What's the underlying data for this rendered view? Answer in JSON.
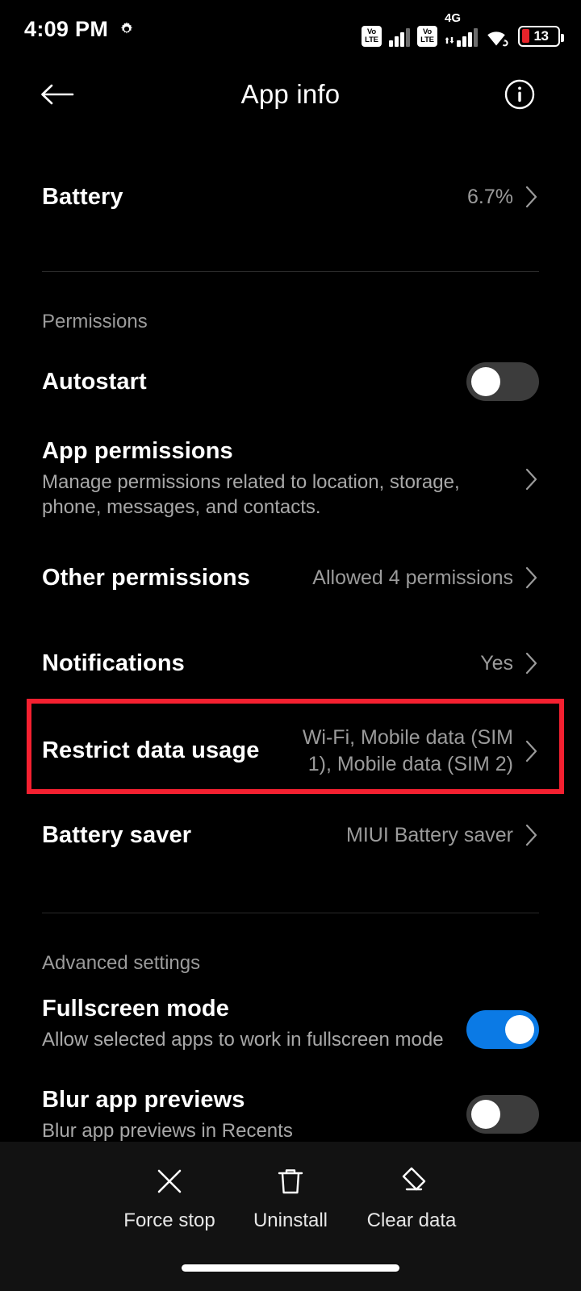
{
  "status_bar": {
    "time": "4:09 PM",
    "gear_icon": "gear-icon",
    "volte_top": "Vo",
    "volte_bottom": "LTE",
    "network_label": "4G",
    "wifi_icon": "wifi-icon",
    "battery_percent": "13"
  },
  "app_bar": {
    "back_icon": "back-arrow-icon",
    "title": "App info",
    "info_icon": "info-icon"
  },
  "rows": {
    "battery": {
      "title": "Battery",
      "value": "6.7%"
    },
    "permissions_label": "Permissions",
    "autostart": {
      "title": "Autostart",
      "toggle": "off"
    },
    "app_permissions": {
      "title": "App permissions",
      "subtitle": "Manage permissions related to location, storage, phone, messages, and contacts."
    },
    "other_permissions": {
      "title": "Other permissions",
      "value": "Allowed 4 permissions"
    },
    "notifications": {
      "title": "Notifications",
      "value": "Yes"
    },
    "restrict_data_usage": {
      "title": "Restrict data usage",
      "value": "Wi-Fi, Mobile data (SIM 1), Mobile data (SIM 2)"
    },
    "battery_saver": {
      "title": "Battery saver",
      "value": "MIUI Battery saver"
    },
    "advanced_label": "Advanced settings",
    "fullscreen_mode": {
      "title": "Fullscreen mode",
      "subtitle": "Allow selected apps to work in fullscreen mode",
      "toggle": "on"
    },
    "blur_app_previews": {
      "title": "Blur app previews",
      "subtitle": "Blur app previews in Recents",
      "toggle": "off"
    }
  },
  "action_bar": {
    "force_stop": {
      "label": "Force stop",
      "icon": "close-x-icon"
    },
    "uninstall": {
      "label": "Uninstall",
      "icon": "trash-icon"
    },
    "clear_data": {
      "label": "Clear data",
      "icon": "eraser-icon"
    }
  },
  "annotation": {
    "highlight_color": "#f42030"
  }
}
